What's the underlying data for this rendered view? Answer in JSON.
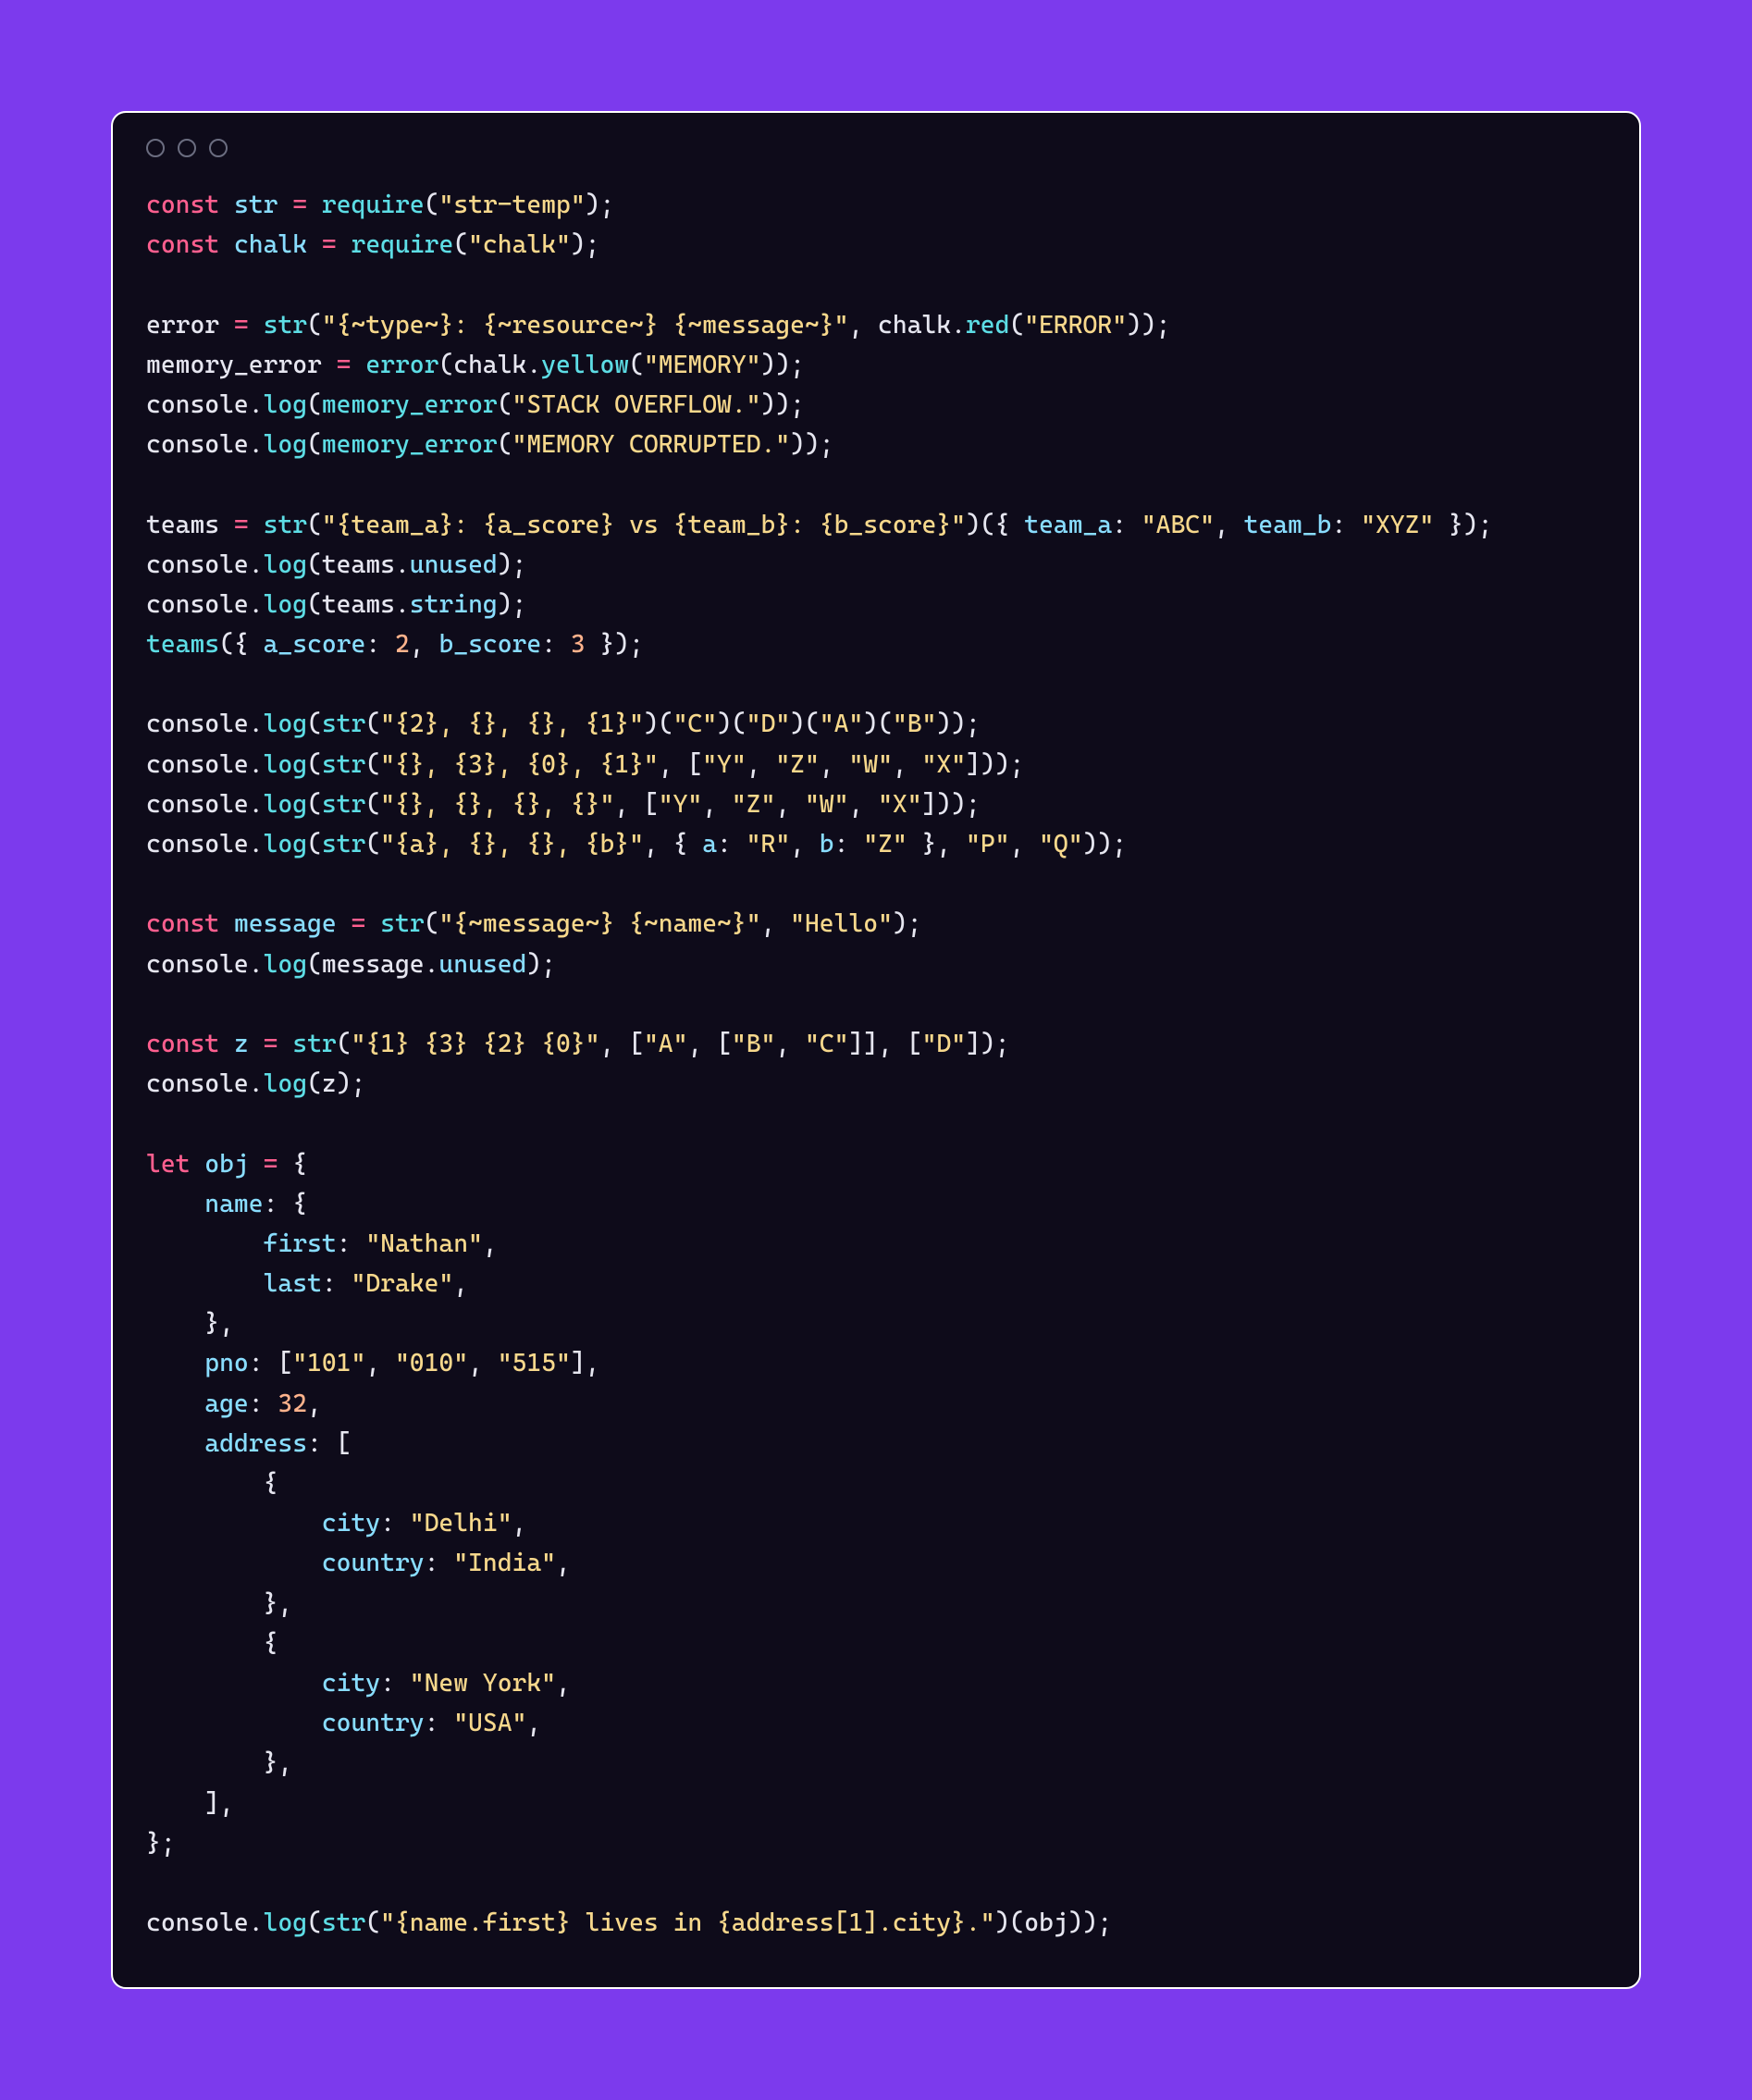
{
  "colors": {
    "page_bg": "#7c3aed",
    "window_bg": "#0e0b1a",
    "window_border": "#ffffff",
    "keyword": "#ff5f8f",
    "variable": "#89ddff",
    "function": "#5ddde5",
    "string": "#f7d88c",
    "number": "#ffb38c",
    "text": "#e6e6f0",
    "circle_border": "#6b6d80"
  },
  "titlebar": {
    "circles": 3
  },
  "code": {
    "tokens": [
      [
        [
          "kw",
          "const"
        ],
        [
          "pn",
          " "
        ],
        [
          "var",
          "str"
        ],
        [
          "pn",
          " "
        ],
        [
          "op",
          "="
        ],
        [
          "pn",
          " "
        ],
        [
          "fn",
          "require"
        ],
        [
          "pn",
          "("
        ],
        [
          "str",
          "\"str-temp\""
        ],
        [
          "pn",
          ");"
        ]
      ],
      [
        [
          "kw",
          "const"
        ],
        [
          "pn",
          " "
        ],
        [
          "var",
          "chalk"
        ],
        [
          "pn",
          " "
        ],
        [
          "op",
          "="
        ],
        [
          "pn",
          " "
        ],
        [
          "fn",
          "require"
        ],
        [
          "pn",
          "("
        ],
        [
          "str",
          "\"chalk\""
        ],
        [
          "pn",
          ");"
        ]
      ],
      [],
      [
        [
          "pn",
          "error "
        ],
        [
          "op",
          "="
        ],
        [
          "pn",
          " "
        ],
        [
          "fn",
          "str"
        ],
        [
          "pn",
          "("
        ],
        [
          "str",
          "\"{~type~}: {~resource~} {~message~}\""
        ],
        [
          "pn",
          ", chalk."
        ],
        [
          "fn",
          "red"
        ],
        [
          "pn",
          "("
        ],
        [
          "str",
          "\"ERROR\""
        ],
        [
          "pn",
          "));"
        ]
      ],
      [
        [
          "pn",
          "memory_error "
        ],
        [
          "op",
          "="
        ],
        [
          "pn",
          " "
        ],
        [
          "fn",
          "error"
        ],
        [
          "pn",
          "(chalk."
        ],
        [
          "fn",
          "yellow"
        ],
        [
          "pn",
          "("
        ],
        [
          "str",
          "\"MEMORY\""
        ],
        [
          "pn",
          "));"
        ]
      ],
      [
        [
          "pn",
          "console."
        ],
        [
          "fn",
          "log"
        ],
        [
          "pn",
          "("
        ],
        [
          "fn",
          "memory_error"
        ],
        [
          "pn",
          "("
        ],
        [
          "str",
          "\"STACK OVERFLOW.\""
        ],
        [
          "pn",
          "));"
        ]
      ],
      [
        [
          "pn",
          "console."
        ],
        [
          "fn",
          "log"
        ],
        [
          "pn",
          "("
        ],
        [
          "fn",
          "memory_error"
        ],
        [
          "pn",
          "("
        ],
        [
          "str",
          "\"MEMORY CORRUPTED.\""
        ],
        [
          "pn",
          "));"
        ]
      ],
      [],
      [
        [
          "pn",
          "teams "
        ],
        [
          "op",
          "="
        ],
        [
          "pn",
          " "
        ],
        [
          "fn",
          "str"
        ],
        [
          "pn",
          "("
        ],
        [
          "str",
          "\"{team_a}: {a_score} vs {team_b}: {b_score}\""
        ],
        [
          "pn",
          ")({ "
        ],
        [
          "key",
          "team_a"
        ],
        [
          "pn",
          ": "
        ],
        [
          "str",
          "\"ABC\""
        ],
        [
          "pn",
          ", "
        ],
        [
          "key",
          "team_b"
        ],
        [
          "pn",
          ": "
        ],
        [
          "str",
          "\"XYZ\""
        ],
        [
          "pn",
          " });"
        ]
      ],
      [
        [
          "pn",
          "console."
        ],
        [
          "fn",
          "log"
        ],
        [
          "pn",
          "(teams."
        ],
        [
          "prop",
          "unused"
        ],
        [
          "pn",
          ");"
        ]
      ],
      [
        [
          "pn",
          "console."
        ],
        [
          "fn",
          "log"
        ],
        [
          "pn",
          "(teams."
        ],
        [
          "prop",
          "string"
        ],
        [
          "pn",
          ");"
        ]
      ],
      [
        [
          "fn",
          "teams"
        ],
        [
          "pn",
          "({ "
        ],
        [
          "key",
          "a_score"
        ],
        [
          "pn",
          ": "
        ],
        [
          "num",
          "2"
        ],
        [
          "pn",
          ", "
        ],
        [
          "key",
          "b_score"
        ],
        [
          "pn",
          ": "
        ],
        [
          "num",
          "3"
        ],
        [
          "pn",
          " });"
        ]
      ],
      [],
      [
        [
          "pn",
          "console."
        ],
        [
          "fn",
          "log"
        ],
        [
          "pn",
          "("
        ],
        [
          "fn",
          "str"
        ],
        [
          "pn",
          "("
        ],
        [
          "str",
          "\"{2}, {}, {}, {1}\""
        ],
        [
          "pn",
          ")("
        ],
        [
          "str",
          "\"C\""
        ],
        [
          "pn",
          ")("
        ],
        [
          "str",
          "\"D\""
        ],
        [
          "pn",
          ")("
        ],
        [
          "str",
          "\"A\""
        ],
        [
          "pn",
          ")("
        ],
        [
          "str",
          "\"B\""
        ],
        [
          "pn",
          "));"
        ]
      ],
      [
        [
          "pn",
          "console."
        ],
        [
          "fn",
          "log"
        ],
        [
          "pn",
          "("
        ],
        [
          "fn",
          "str"
        ],
        [
          "pn",
          "("
        ],
        [
          "str",
          "\"{}, {3}, {0}, {1}\""
        ],
        [
          "pn",
          ", ["
        ],
        [
          "str",
          "\"Y\""
        ],
        [
          "pn",
          ", "
        ],
        [
          "str",
          "\"Z\""
        ],
        [
          "pn",
          ", "
        ],
        [
          "str",
          "\"W\""
        ],
        [
          "pn",
          ", "
        ],
        [
          "str",
          "\"X\""
        ],
        [
          "pn",
          "]));"
        ]
      ],
      [
        [
          "pn",
          "console."
        ],
        [
          "fn",
          "log"
        ],
        [
          "pn",
          "("
        ],
        [
          "fn",
          "str"
        ],
        [
          "pn",
          "("
        ],
        [
          "str",
          "\"{}, {}, {}, {}\""
        ],
        [
          "pn",
          ", ["
        ],
        [
          "str",
          "\"Y\""
        ],
        [
          "pn",
          ", "
        ],
        [
          "str",
          "\"Z\""
        ],
        [
          "pn",
          ", "
        ],
        [
          "str",
          "\"W\""
        ],
        [
          "pn",
          ", "
        ],
        [
          "str",
          "\"X\""
        ],
        [
          "pn",
          "]));"
        ]
      ],
      [
        [
          "pn",
          "console."
        ],
        [
          "fn",
          "log"
        ],
        [
          "pn",
          "("
        ],
        [
          "fn",
          "str"
        ],
        [
          "pn",
          "("
        ],
        [
          "str",
          "\"{a}, {}, {}, {b}\""
        ],
        [
          "pn",
          ", { "
        ],
        [
          "key",
          "a"
        ],
        [
          "pn",
          ": "
        ],
        [
          "str",
          "\"R\""
        ],
        [
          "pn",
          ", "
        ],
        [
          "key",
          "b"
        ],
        [
          "pn",
          ": "
        ],
        [
          "str",
          "\"Z\""
        ],
        [
          "pn",
          " }, "
        ],
        [
          "str",
          "\"P\""
        ],
        [
          "pn",
          ", "
        ],
        [
          "str",
          "\"Q\""
        ],
        [
          "pn",
          "));"
        ]
      ],
      [],
      [
        [
          "kw",
          "const"
        ],
        [
          "pn",
          " "
        ],
        [
          "var",
          "message"
        ],
        [
          "pn",
          " "
        ],
        [
          "op",
          "="
        ],
        [
          "pn",
          " "
        ],
        [
          "fn",
          "str"
        ],
        [
          "pn",
          "("
        ],
        [
          "str",
          "\"{~message~} {~name~}\""
        ],
        [
          "pn",
          ", "
        ],
        [
          "str",
          "\"Hello\""
        ],
        [
          "pn",
          ");"
        ]
      ],
      [
        [
          "pn",
          "console."
        ],
        [
          "fn",
          "log"
        ],
        [
          "pn",
          "(message."
        ],
        [
          "prop",
          "unused"
        ],
        [
          "pn",
          ");"
        ]
      ],
      [],
      [
        [
          "kw",
          "const"
        ],
        [
          "pn",
          " "
        ],
        [
          "var",
          "z"
        ],
        [
          "pn",
          " "
        ],
        [
          "op",
          "="
        ],
        [
          "pn",
          " "
        ],
        [
          "fn",
          "str"
        ],
        [
          "pn",
          "("
        ],
        [
          "str",
          "\"{1} {3} {2} {0}\""
        ],
        [
          "pn",
          ", ["
        ],
        [
          "str",
          "\"A\""
        ],
        [
          "pn",
          ", ["
        ],
        [
          "str",
          "\"B\""
        ],
        [
          "pn",
          ", "
        ],
        [
          "str",
          "\"C\""
        ],
        [
          "pn",
          "]], ["
        ],
        [
          "str",
          "\"D\""
        ],
        [
          "pn",
          "]);"
        ]
      ],
      [
        [
          "pn",
          "console."
        ],
        [
          "fn",
          "log"
        ],
        [
          "pn",
          "(z);"
        ]
      ],
      [],
      [
        [
          "kw",
          "let"
        ],
        [
          "pn",
          " "
        ],
        [
          "var",
          "obj"
        ],
        [
          "pn",
          " "
        ],
        [
          "op",
          "="
        ],
        [
          "pn",
          " {"
        ]
      ],
      [
        [
          "pn",
          "    "
        ],
        [
          "key",
          "name"
        ],
        [
          "pn",
          ": {"
        ]
      ],
      [
        [
          "pn",
          "        "
        ],
        [
          "key",
          "first"
        ],
        [
          "pn",
          ": "
        ],
        [
          "str",
          "\"Nathan\""
        ],
        [
          "pn",
          ","
        ]
      ],
      [
        [
          "pn",
          "        "
        ],
        [
          "key",
          "last"
        ],
        [
          "pn",
          ": "
        ],
        [
          "str",
          "\"Drake\""
        ],
        [
          "pn",
          ","
        ]
      ],
      [
        [
          "pn",
          "    },"
        ]
      ],
      [
        [
          "pn",
          "    "
        ],
        [
          "key",
          "pno"
        ],
        [
          "pn",
          ": ["
        ],
        [
          "str",
          "\"101\""
        ],
        [
          "pn",
          ", "
        ],
        [
          "str",
          "\"010\""
        ],
        [
          "pn",
          ", "
        ],
        [
          "str",
          "\"515\""
        ],
        [
          "pn",
          "],"
        ]
      ],
      [
        [
          "pn",
          "    "
        ],
        [
          "key",
          "age"
        ],
        [
          "pn",
          ": "
        ],
        [
          "num",
          "32"
        ],
        [
          "pn",
          ","
        ]
      ],
      [
        [
          "pn",
          "    "
        ],
        [
          "key",
          "address"
        ],
        [
          "pn",
          ": ["
        ]
      ],
      [
        [
          "pn",
          "        {"
        ]
      ],
      [
        [
          "pn",
          "            "
        ],
        [
          "key",
          "city"
        ],
        [
          "pn",
          ": "
        ],
        [
          "str",
          "\"Delhi\""
        ],
        [
          "pn",
          ","
        ]
      ],
      [
        [
          "pn",
          "            "
        ],
        [
          "key",
          "country"
        ],
        [
          "pn",
          ": "
        ],
        [
          "str",
          "\"India\""
        ],
        [
          "pn",
          ","
        ]
      ],
      [
        [
          "pn",
          "        },"
        ]
      ],
      [
        [
          "pn",
          "        {"
        ]
      ],
      [
        [
          "pn",
          "            "
        ],
        [
          "key",
          "city"
        ],
        [
          "pn",
          ": "
        ],
        [
          "str",
          "\"New York\""
        ],
        [
          "pn",
          ","
        ]
      ],
      [
        [
          "pn",
          "            "
        ],
        [
          "key",
          "country"
        ],
        [
          "pn",
          ": "
        ],
        [
          "str",
          "\"USA\""
        ],
        [
          "pn",
          ","
        ]
      ],
      [
        [
          "pn",
          "        },"
        ]
      ],
      [
        [
          "pn",
          "    ],"
        ]
      ],
      [
        [
          "pn",
          "};"
        ]
      ],
      [],
      [
        [
          "pn",
          "console."
        ],
        [
          "fn",
          "log"
        ],
        [
          "pn",
          "("
        ],
        [
          "fn",
          "str"
        ],
        [
          "pn",
          "("
        ],
        [
          "str",
          "\"{name.first} lives in {address[1].city}.\""
        ],
        [
          "pn",
          ")(obj));"
        ]
      ]
    ]
  }
}
